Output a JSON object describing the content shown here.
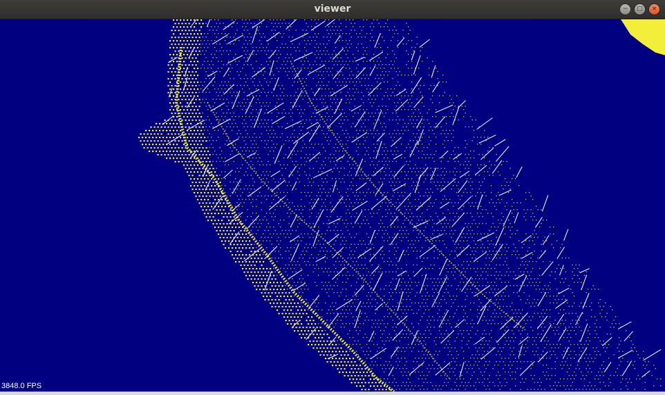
{
  "window": {
    "title": "viewer",
    "controls": {
      "minimize_glyph": "−",
      "maximize_glyph": "□",
      "close_glyph": "×"
    }
  },
  "viewport": {
    "background_color": "#000080",
    "point_color": "#f2ee3a",
    "normal_color": "#f3f3f3",
    "fps_text": "3848.0 FPS"
  }
}
